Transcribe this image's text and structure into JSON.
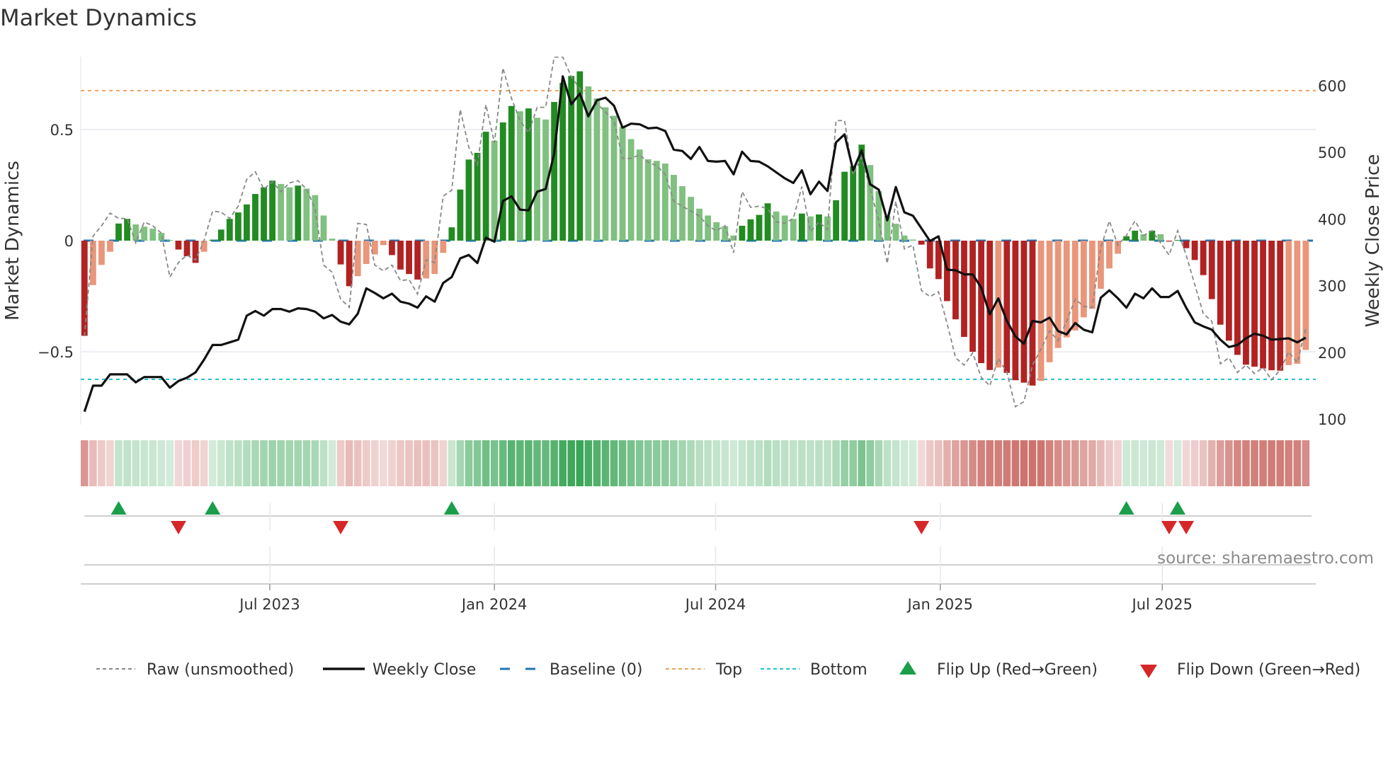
{
  "chart_data": {
    "type": "bar",
    "title": "Market Dynamics",
    "ylabel": "Market Dynamics",
    "y2label": "Weekly Close Price",
    "ylim": [
      -0.83,
      0.83
    ],
    "y2lim": [
      100,
      640
    ],
    "yticks": [
      {
        "value": 0.5,
        "label": "0.5"
      },
      {
        "value": 0,
        "label": "0"
      },
      {
        "value": -0.5,
        "label": "−0.5"
      }
    ],
    "y2ticks": [
      {
        "value": 600,
        "label": "600"
      },
      {
        "value": 500,
        "label": "500"
      },
      {
        "value": 400,
        "label": "400"
      },
      {
        "value": 300,
        "label": "300"
      },
      {
        "value": 200,
        "label": "200"
      },
      {
        "value": 100,
        "label": "100"
      }
    ],
    "x_unit": "week index (weekly bars)",
    "x_ticks": [
      {
        "week": 21.7,
        "label": "Jul 2023"
      },
      {
        "week": 48.0,
        "label": "Jan 2024"
      },
      {
        "week": 73.9,
        "label": "Jul 2024"
      },
      {
        "week": 100.2,
        "label": "Jan 2025"
      },
      {
        "week": 126.2,
        "label": "Jul 2025"
      }
    ],
    "grid": true,
    "top_level": 0.675,
    "bottom_level": -0.624,
    "baseline": 0,
    "series": [
      {
        "name": "Market Dynamics (smoothed)",
        "type": "bar",
        "values": [
          -0.428,
          -0.2,
          -0.109,
          -0.05,
          0.077,
          0.098,
          0.073,
          0.063,
          0.054,
          0.035,
          0.003,
          -0.04,
          -0.07,
          -0.1,
          -0.05,
          0.004,
          0.05,
          0.098,
          0.127,
          0.163,
          0.21,
          0.24,
          0.27,
          0.255,
          0.24,
          0.248,
          0.234,
          0.205,
          0.113,
          0.009,
          -0.107,
          -0.205,
          -0.16,
          -0.105,
          -0.062,
          -0.02,
          -0.065,
          -0.13,
          -0.15,
          -0.175,
          -0.17,
          -0.15,
          -0.055,
          0.06,
          0.23,
          0.365,
          0.395,
          0.49,
          0.45,
          0.532,
          0.606,
          0.582,
          0.595,
          0.553,
          0.545,
          0.624,
          0.71,
          0.741,
          0.762,
          0.694,
          0.64,
          0.6,
          0.562,
          0.513,
          0.457,
          0.41,
          0.366,
          0.359,
          0.347,
          0.296,
          0.245,
          0.197,
          0.144,
          0.113,
          0.083,
          0.065,
          0.023,
          0.067,
          0.096,
          0.116,
          0.168,
          0.131,
          0.113,
          0.098,
          0.122,
          0.109,
          0.118,
          0.109,
          0.182,
          0.31,
          0.335,
          0.432,
          0.34,
          0.223,
          0.111,
          0.076,
          0.023,
          0.005,
          -0.018,
          -0.125,
          -0.173,
          -0.272,
          -0.354,
          -0.433,
          -0.5,
          -0.551,
          -0.582,
          -0.571,
          -0.595,
          -0.628,
          -0.639,
          -0.652,
          -0.631,
          -0.547,
          -0.483,
          -0.435,
          -0.404,
          -0.345,
          -0.307,
          -0.217,
          -0.125,
          -0.059,
          0.02,
          0.045,
          0.029,
          0.045,
          0.029,
          -0.004,
          0.003,
          -0.034,
          -0.087,
          -0.155,
          -0.263,
          -0.378,
          -0.45,
          -0.514,
          -0.558,
          -0.567,
          -0.575,
          -0.583,
          -0.585,
          -0.56,
          -0.554,
          -0.492
        ]
      },
      {
        "name": "Raw (unsmoothed)",
        "type": "line",
        "values": [
          -0.43,
          0.02,
          0.067,
          0.124,
          0.1,
          0.1,
          -0.01,
          0.084,
          0.067,
          0.034,
          -0.164,
          -0.098,
          -0.065,
          -0.087,
          0.0,
          0.133,
          0.128,
          0.1,
          0.155,
          0.276,
          0.31,
          0.232,
          0.265,
          0.22,
          0.26,
          0.27,
          0.232,
          0.144,
          -0.11,
          -0.142,
          -0.263,
          -0.3,
          0.078,
          0.073,
          -0.11,
          -0.136,
          -0.11,
          -0.18,
          -0.175,
          -0.24,
          -0.087,
          -0.098,
          0.2,
          0.227,
          0.59,
          0.42,
          0.342,
          0.612,
          0.44,
          0.777,
          0.64,
          0.54,
          0.485,
          0.6,
          0.6,
          0.826,
          0.826,
          0.738,
          0.683,
          0.562,
          0.617,
          0.579,
          0.54,
          0.37,
          0.37,
          0.386,
          0.353,
          0.337,
          0.298,
          0.177,
          0.155,
          0.133,
          0.11,
          0.067,
          0.045,
          0.067,
          -0.054,
          0.221,
          0.15,
          0.155,
          0.144,
          0.084,
          0.078,
          0.1,
          0.243,
          0.04,
          0.084,
          0.05,
          0.54,
          0.54,
          0.298,
          0.375,
          0.232,
          0.089,
          -0.103,
          0.177,
          -0.037,
          -0.02,
          -0.224,
          -0.252,
          -0.23,
          -0.373,
          -0.527,
          -0.56,
          -0.505,
          -0.615,
          -0.653,
          -0.53,
          -0.593,
          -0.747,
          -0.725,
          -0.56,
          -0.488,
          -0.406,
          -0.45,
          -0.362,
          -0.263,
          -0.296,
          -0.301,
          -0.032,
          0.089,
          -0.02,
          0.023,
          0.089,
          0.023,
          0.045,
          -0.01,
          -0.065,
          0.045,
          -0.065,
          -0.197,
          -0.329,
          -0.362,
          -0.554,
          -0.527,
          -0.593,
          -0.56,
          -0.598,
          -0.571,
          -0.626,
          -0.582,
          -0.5,
          -0.549,
          -0.395
        ]
      },
      {
        "name": "Weekly Close",
        "type": "line",
        "axis": "right",
        "values": [
          111,
          150,
          150,
          167,
          167,
          167,
          155,
          163,
          163,
          163,
          147,
          157,
          162,
          170,
          189,
          211,
          211,
          215,
          219,
          255,
          262,
          255,
          265,
          265,
          261,
          266,
          265,
          261,
          251,
          256,
          246,
          242,
          258,
          296,
          289,
          281,
          288,
          276,
          273,
          267,
          284,
          276,
          304,
          313,
          341,
          346,
          334,
          372,
          366,
          427,
          434,
          414,
          413,
          441,
          445,
          498,
          614,
          572,
          588,
          554,
          578,
          582,
          570,
          537,
          543,
          542,
          536,
          537,
          532,
          504,
          502,
          490,
          508,
          487,
          486,
          487,
          467,
          501,
          487,
          486,
          479,
          470,
          461,
          454,
          473,
          437,
          456,
          442,
          515,
          527,
          473,
          503,
          452,
          444,
          398,
          448,
          410,
          405,
          386,
          367,
          374,
          324,
          323,
          317,
          317,
          297,
          257,
          281,
          247,
          224,
          213,
          247,
          245,
          252,
          232,
          227,
          244,
          234,
          230,
          282,
          293,
          281,
          267,
          288,
          281,
          296,
          283,
          283,
          292,
          267,
          245,
          239,
          234,
          219,
          208,
          211,
          221,
          228,
          225,
          219,
          220,
          221,
          215,
          222
        ]
      }
    ],
    "flip_up_weeks": [
      4,
      15,
      43,
      122,
      128
    ],
    "flip_down_weeks": [
      11,
      30,
      98,
      127,
      129
    ],
    "legend": {
      "placement": "bottom",
      "items": [
        {
          "label": "Raw (unsmoothed)",
          "marker": "dashed-gray-line"
        },
        {
          "label": "Weekly Close",
          "marker": "solid-black-line"
        },
        {
          "label": "Baseline (0)",
          "marker": "dashed-blue-line"
        },
        {
          "label": "Top",
          "marker": "dotted-orange-line"
        },
        {
          "label": "Bottom",
          "marker": "dotted-cyan-line"
        },
        {
          "label": "Flip Up (Red→Green)",
          "marker": "green-up-triangle"
        },
        {
          "label": "Flip Down (Green→Red)",
          "marker": "red-down-triangle"
        }
      ]
    },
    "source": "source: sharemaestro.com",
    "colors": {
      "green_strong": "#228b22",
      "green_weak": "#80c080",
      "red_strong": "#b22222",
      "red_weak": "#e9967a",
      "raw": "#888888",
      "close": "#111111",
      "baseline": "#1f77b4",
      "top": "#f0a868",
      "bottom": "#2ec4d6",
      "flip_up": "#1a9e4a",
      "flip_down": "#d62728",
      "heat_green": "#3aa557",
      "heat_red": "#c6605a"
    }
  }
}
